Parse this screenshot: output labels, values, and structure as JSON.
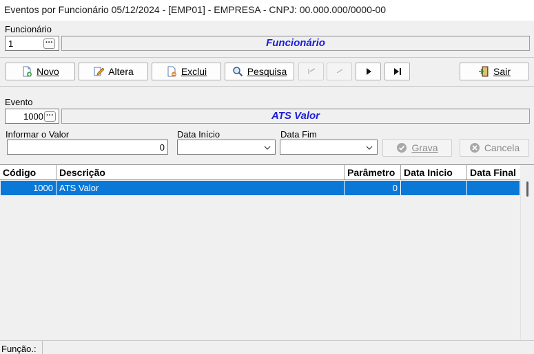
{
  "window": {
    "title": "Eventos por Funcionário 05/12/2024 - [EMP01] - EMPRESA - CNPJ: 00.000.000/0000-00"
  },
  "funcionario": {
    "label": "Funcionário",
    "code": "1",
    "name": "Funcionário"
  },
  "toolbar": {
    "novo": "Novo",
    "altera": "Altera",
    "exclui": "Exclui",
    "pesquisa": "Pesquisa",
    "sair": "Sair"
  },
  "evento": {
    "label": "Evento",
    "code": "1000",
    "name": "ATS Valor"
  },
  "form": {
    "valor_label": "Informar o Valor",
    "valor": "0",
    "data_inicio_label": "Data Início",
    "data_inicio": "",
    "data_fim_label": "Data Fim",
    "data_fim": "",
    "grava": "Grava",
    "cancela": "Cancela"
  },
  "grid": {
    "columns": [
      "Código",
      "Descrição",
      "Parâmetro",
      "Data Inicio",
      "Data Final"
    ],
    "rows": [
      {
        "codigo": "1000",
        "descricao": "ATS Valor",
        "parametro": "0",
        "data_inicio": "",
        "data_final": ""
      }
    ]
  },
  "status": {
    "funcao": "Função.:"
  },
  "colors": {
    "accent": "#0a78d7",
    "banner_text": "#1c1cd9"
  }
}
